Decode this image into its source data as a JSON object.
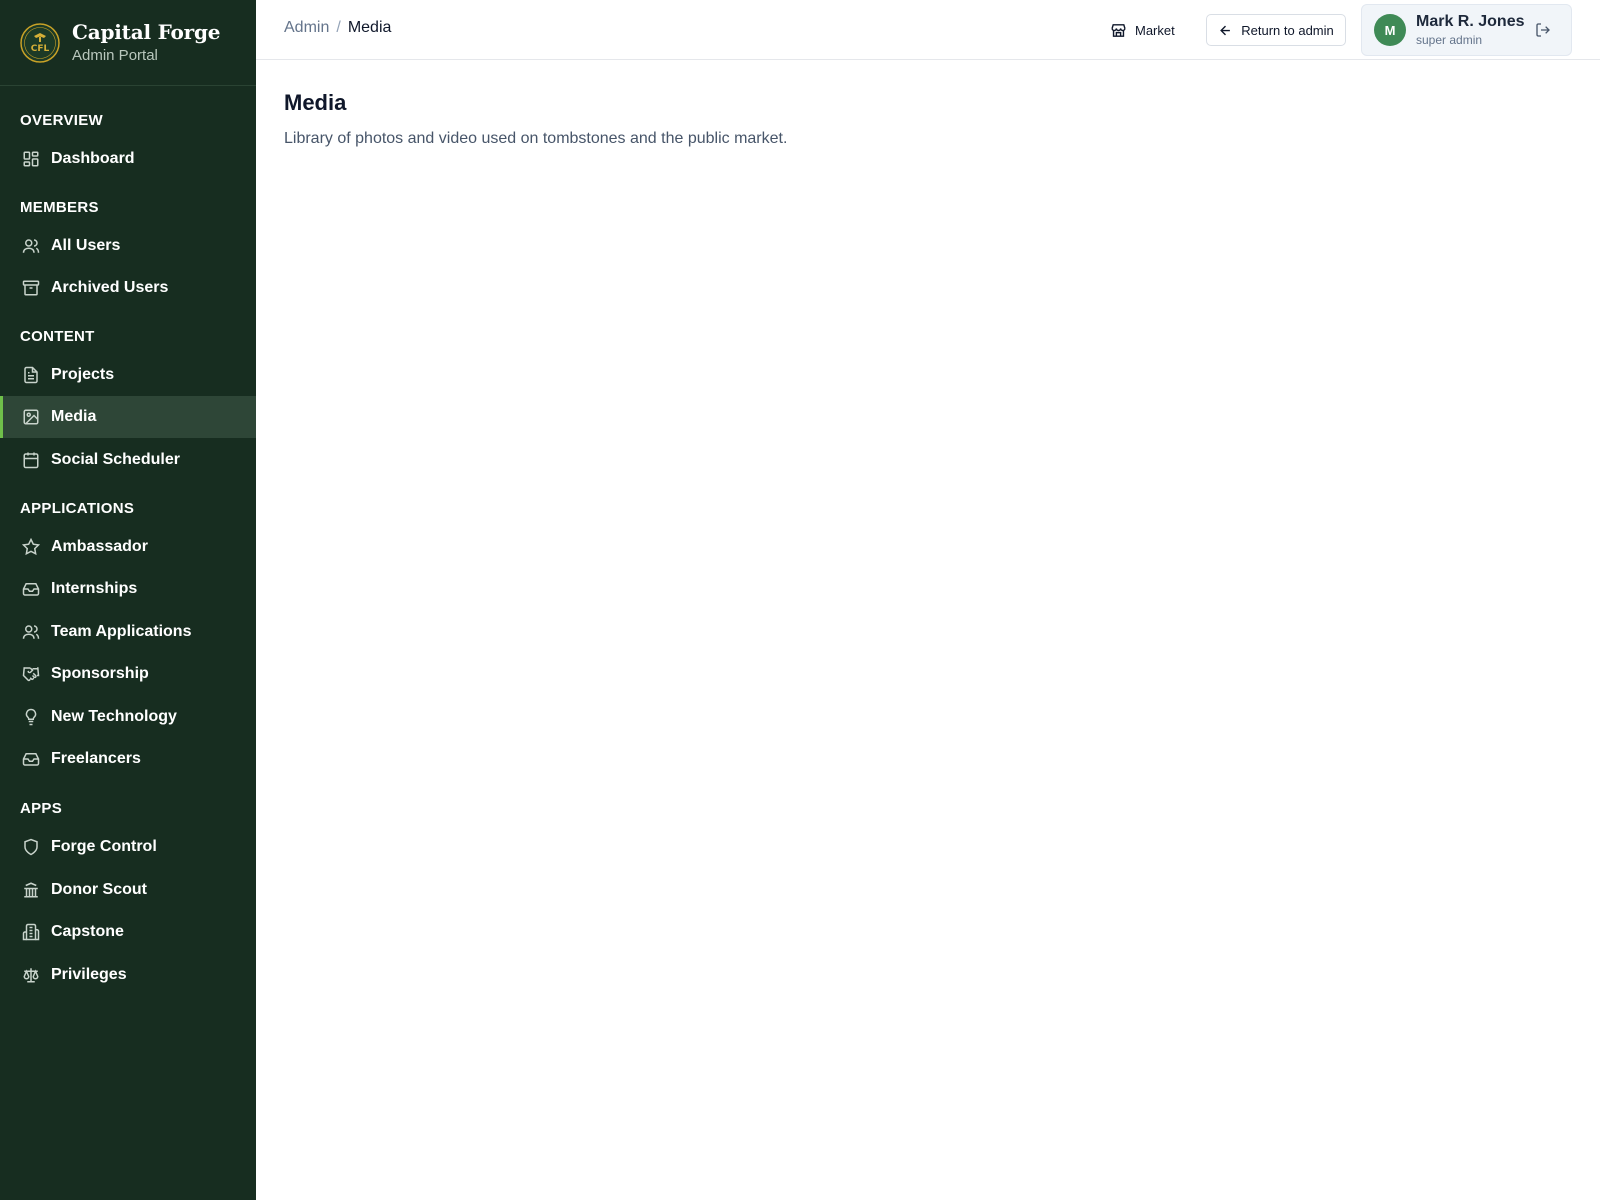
{
  "brand": {
    "logo_text": "CFL",
    "name": "Capital Forge",
    "subtitle": "Admin Portal"
  },
  "sidebar": {
    "sections": [
      {
        "title": "OVERVIEW",
        "items": [
          {
            "label": "Dashboard",
            "icon": "dashboard-icon"
          }
        ]
      },
      {
        "title": "MEMBERS",
        "items": [
          {
            "label": "All Users",
            "icon": "users-icon"
          },
          {
            "label": "Archived Users",
            "icon": "archive-icon"
          }
        ]
      },
      {
        "title": "CONTENT",
        "items": [
          {
            "label": "Projects",
            "icon": "file-text-icon"
          },
          {
            "label": "Media",
            "icon": "image-icon",
            "active": true
          },
          {
            "label": "Social Scheduler",
            "icon": "calendar-icon"
          }
        ]
      },
      {
        "title": "APPLICATIONS",
        "items": [
          {
            "label": "Ambassador",
            "icon": "star-icon"
          },
          {
            "label": "Internships",
            "icon": "inbox-icon"
          },
          {
            "label": "Team Applications",
            "icon": "users-icon"
          },
          {
            "label": "Sponsorship",
            "icon": "handshake-icon"
          },
          {
            "label": "New Technology",
            "icon": "lightbulb-icon"
          },
          {
            "label": "Freelancers",
            "icon": "inbox-icon"
          }
        ]
      },
      {
        "title": "APPS",
        "items": [
          {
            "label": "Forge Control",
            "icon": "shield-icon"
          },
          {
            "label": "Donor Scout",
            "icon": "bank-icon"
          },
          {
            "label": "Capstone",
            "icon": "building-icon"
          },
          {
            "label": "Privileges",
            "icon": "scale-icon"
          }
        ]
      }
    ]
  },
  "topbar": {
    "breadcrumb": {
      "root": "Admin",
      "separator": "/",
      "current": "Media"
    },
    "market_label": "Market",
    "return_label": "Return to admin",
    "user": {
      "initial": "M",
      "name": "Mark R. Jones",
      "role": "super admin"
    }
  },
  "main": {
    "title": "Media",
    "description": "Library of photos and video used on tombstones and the public market."
  },
  "colors": {
    "sidebar_bg": "#172d20",
    "active_bg": "#2e4637",
    "active_accent": "#6fbf4a",
    "avatar_bg": "#3f8a56"
  }
}
